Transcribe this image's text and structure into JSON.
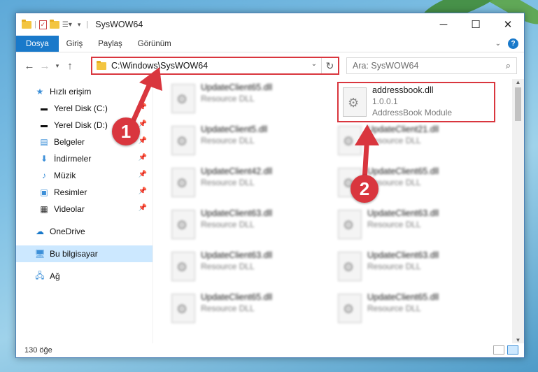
{
  "window": {
    "title": "SysWOW64",
    "controls": [
      "─",
      "☐",
      "✕"
    ]
  },
  "ribbon": {
    "tabs": [
      "Dosya",
      "Giriş",
      "Paylaş",
      "Görünüm"
    ]
  },
  "address_bar": {
    "path": "C:\\Windows\\SysWOW64"
  },
  "search": {
    "placeholder": "Ara: SysWOW64"
  },
  "sidebar": {
    "quick_access": "Hızlı erişim",
    "items": [
      {
        "label": "Yerel Disk (C:)",
        "icon": "drive-icon"
      },
      {
        "label": "Yerel Disk (D:)",
        "icon": "drive-icon"
      },
      {
        "label": "Belgeler",
        "icon": "documents-icon"
      },
      {
        "label": "İndirmeler",
        "icon": "downloads-icon"
      },
      {
        "label": "Müzik",
        "icon": "music-icon"
      },
      {
        "label": "Resimler",
        "icon": "pictures-icon"
      },
      {
        "label": "Videolar",
        "icon": "videos-icon"
      }
    ],
    "onedrive": "OneDrive",
    "this_pc": "Bu bilgisayar",
    "network": "Ağ"
  },
  "files": {
    "highlighted": {
      "name": "addressbook.dll",
      "version": "1.0.0.1",
      "description": "AddressBook Module"
    },
    "left_column": [
      {
        "name": "UpdateClient65.dll",
        "type": "Resource DLL"
      },
      {
        "name": "UpdateClient5.dll",
        "type": "Resource DLL"
      },
      {
        "name": "UpdateClient42.dll",
        "type": "Resource DLL"
      },
      {
        "name": "UpdateClient63.dll",
        "type": "Resource DLL"
      },
      {
        "name": "UpdateClient63.dll",
        "type": "Resource DLL"
      },
      {
        "name": "UpdateClient65.dll",
        "type": "Resource DLL"
      }
    ],
    "right_column": [
      {
        "name": "UpdateClient21.dll",
        "type": "Resource DLL"
      },
      {
        "name": "UpdateClient65.dll",
        "type": "Resource DLL"
      },
      {
        "name": "UpdateClient63.dll",
        "type": "Resource DLL"
      },
      {
        "name": "UpdateClient63.dll",
        "type": "Resource DLL"
      },
      {
        "name": "UpdateClient65.dll",
        "type": "Resource DLL"
      }
    ]
  },
  "status": {
    "count": "130 öğe"
  },
  "annotations": {
    "step1": "1",
    "step2": "2",
    "color": "#d9363e"
  }
}
